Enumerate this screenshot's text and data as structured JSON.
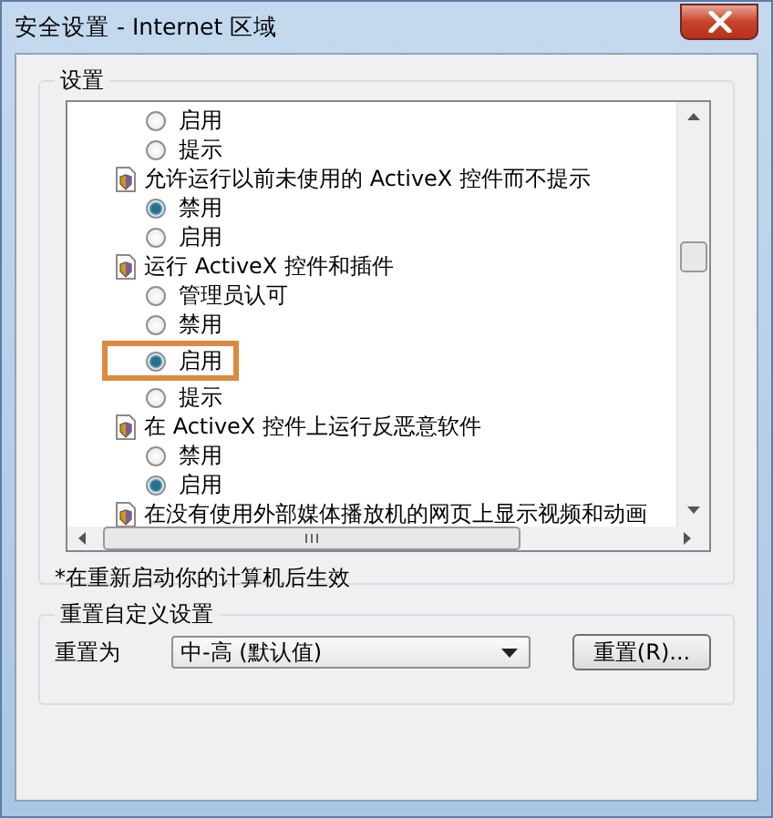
{
  "window": {
    "title": "安全设置 - Internet 区域"
  },
  "settings_group": {
    "title": "设置",
    "rows": [
      {
        "kind": "option",
        "label": "启用",
        "selected": false,
        "highlighted": false
      },
      {
        "kind": "option",
        "label": "提示",
        "selected": false,
        "highlighted": false
      },
      {
        "kind": "setting",
        "label": "允许运行以前未使用的 ActiveX 控件而不提示",
        "options": [
          {
            "label": "禁用",
            "selected": true,
            "highlighted": false
          },
          {
            "label": "启用",
            "selected": false,
            "highlighted": false
          }
        ]
      },
      {
        "kind": "setting",
        "label": "运行 ActiveX 控件和插件",
        "options": [
          {
            "label": "管理员认可",
            "selected": false,
            "highlighted": false
          },
          {
            "label": "禁用",
            "selected": false,
            "highlighted": false
          },
          {
            "label": "启用",
            "selected": true,
            "highlighted": true
          },
          {
            "label": "提示",
            "selected": false,
            "highlighted": false
          }
        ]
      },
      {
        "kind": "setting",
        "label": "在 ActiveX 控件上运行反恶意软件",
        "options": [
          {
            "label": "禁用",
            "selected": false,
            "highlighted": false
          },
          {
            "label": "启用",
            "selected": true,
            "highlighted": false
          }
        ]
      },
      {
        "kind": "setting",
        "label": "在没有使用外部媒体播放机的网页上显示视频和动画",
        "options": []
      }
    ],
    "note": "*在重新启动你的计算机后生效"
  },
  "reset_group": {
    "title": "重置自定义设置",
    "label": "重置为",
    "dropdown": {
      "value": "中-高 (默认值)"
    },
    "button": "重置(R)..."
  }
}
